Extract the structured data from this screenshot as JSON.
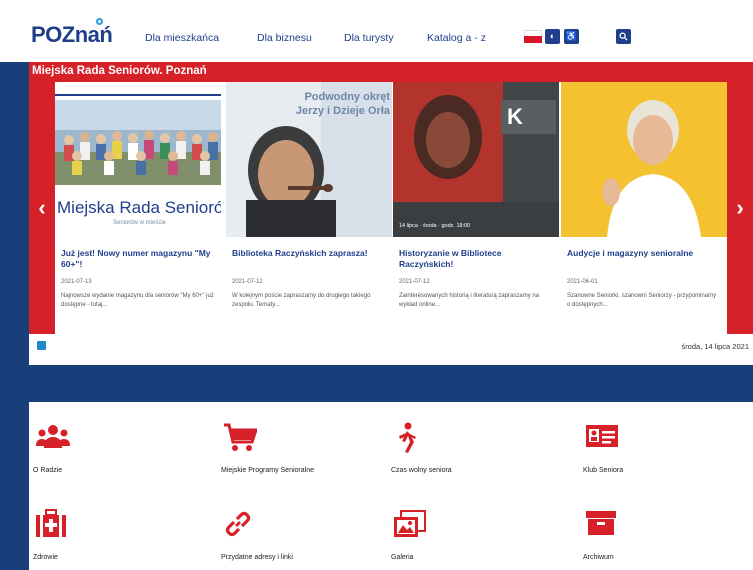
{
  "header": {
    "logo": "POZnań",
    "nav": [
      "Dla mieszkańca",
      "Dla biznesu",
      "Dla turysty",
      "Katalog a - z"
    ],
    "search_icon": "search-icon",
    "contrast_icon": "contrast-icon",
    "accessibility_icon": "accessibility-icon"
  },
  "site": {
    "title": "Miejska Rada Seniorów. Poznań"
  },
  "carousel": {
    "prev_icon": "chevron-left-icon",
    "next_icon": "chevron-right-icon",
    "cards": [
      {
        "image_caption": "Miejska Rada Seniorów",
        "image_subcaption": "Seniorów w mieście",
        "title": "Już jest! Nowy numer magazynu \"My 60+\"!",
        "date": "2021-07-13",
        "text": "Najnowsze wydanie magazynu dla seniorów \"My 60+\" już dostępne - tutaj..."
      },
      {
        "image_caption": "Podwodny okręt Jerzy i Dzieje Orła",
        "title": "Biblioteka Raczyńskich zaprasza!",
        "date": "2021-07-12",
        "text": "W kolejnym poście zapraszamy do drugiego takiego zespołu. Tematy..."
      },
      {
        "image_caption": "K",
        "image_subcaption": "14 lipca · środa · godz. 18:00",
        "title": "Historyzanie w Bibliotece Raczyńskich!",
        "date": "2021-07-12",
        "text": "Zainteresowanych historią i literaturą zapraszamy na wykład online..."
      },
      {
        "title": "Audycje i magazyny senioralne",
        "date": "2021-06-01",
        "text": "Szanowne Seniorki, szanowni Seniorzy - przypominamy o dostępnych..."
      }
    ]
  },
  "date_text": "środa, 14 lipca 2021",
  "tiles": [
    {
      "label": "O Radzie",
      "icon": "users-icon"
    },
    {
      "label": "Miejskie Programy Senioralne",
      "icon": "cart-icon"
    },
    {
      "label": "Czas wolny seniora",
      "icon": "walking-person-icon"
    },
    {
      "label": "Klub Seniora",
      "icon": "id-card-icon"
    },
    {
      "label": "Zdrowie",
      "icon": "medical-kit-icon"
    },
    {
      "label": "Przydatne adresy i linki",
      "icon": "link-icon"
    },
    {
      "label": "Galeria",
      "icon": "gallery-icon"
    },
    {
      "label": "Archiwum",
      "icon": "archive-icon"
    }
  ],
  "colors": {
    "brand_blue": "#1f3f8a",
    "navy": "#183f7a",
    "red": "#d62128",
    "accent_blue": "#2a9fd8"
  }
}
